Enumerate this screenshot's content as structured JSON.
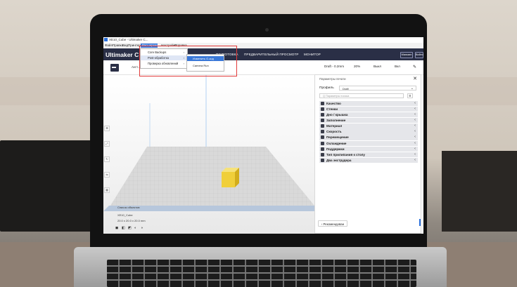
{
  "window": {
    "title": "XE10_Cube - Ultimaker C..."
  },
  "menu": [
    "Файл",
    "Правка",
    "Вид",
    "Принтер",
    "Расширения",
    "Настройки",
    "Справка"
  ],
  "header": {
    "logo": "Ultimaker C",
    "stages": [
      "ПОДГОТОВКА",
      "ПРЕДВАРИТЕЛЬНЫЙ ПРОСМОТР",
      "МОНИТОР"
    ],
    "marketplace": "Магазин",
    "signin": "Войти"
  },
  "toolbar": {
    "printer_label": "Ангт...",
    "profile_summary": "Draft - 0.2mm",
    "infill": "20%",
    "support": "Выкл",
    "adhesion": "Вкл"
  },
  "extensions_menu": {
    "title": "Расширения",
    "items": [
      "Core Backups",
      "Post-обработка",
      "Проверка обновлений"
    ],
    "submenu": [
      "Изменить G-код",
      "Camera Run"
    ]
  },
  "panel": {
    "title": "Параметры печати",
    "profile_label": "Профиль",
    "profile_value": "Draft",
    "search_placeholder": "Q  Параметры поиска",
    "categories": [
      {
        "icon": "quality-icon",
        "label": "Качество"
      },
      {
        "icon": "walls-icon",
        "label": "Стенки"
      },
      {
        "icon": "topbottom-icon",
        "label": "Дно / крышка"
      },
      {
        "icon": "infill-icon",
        "label": "Заполнение"
      },
      {
        "icon": "material-icon",
        "label": "Материал"
      },
      {
        "icon": "speed-icon",
        "label": "Скорость"
      },
      {
        "icon": "travel-icon",
        "label": "Перемещение"
      },
      {
        "icon": "cooling-icon",
        "label": "Охлаждение"
      },
      {
        "icon": "support-icon",
        "label": "Поддержки"
      },
      {
        "icon": "adhesion-icon",
        "label": "Тип прилипания к столу"
      },
      {
        "icon": "dual-icon",
        "label": "Два экструдера"
      }
    ],
    "recommended_button": "Рекомендован"
  },
  "viewport": {
    "object_list": "Список объектов",
    "file_name": "XE10_Cube",
    "dimensions": "20.0 x 20.0 x 20.0 mm"
  },
  "colors": {
    "header": "#2a2f46",
    "accent": "#3a78d8",
    "highlight": "#e23a3a",
    "cube": "#f0cf3a"
  }
}
